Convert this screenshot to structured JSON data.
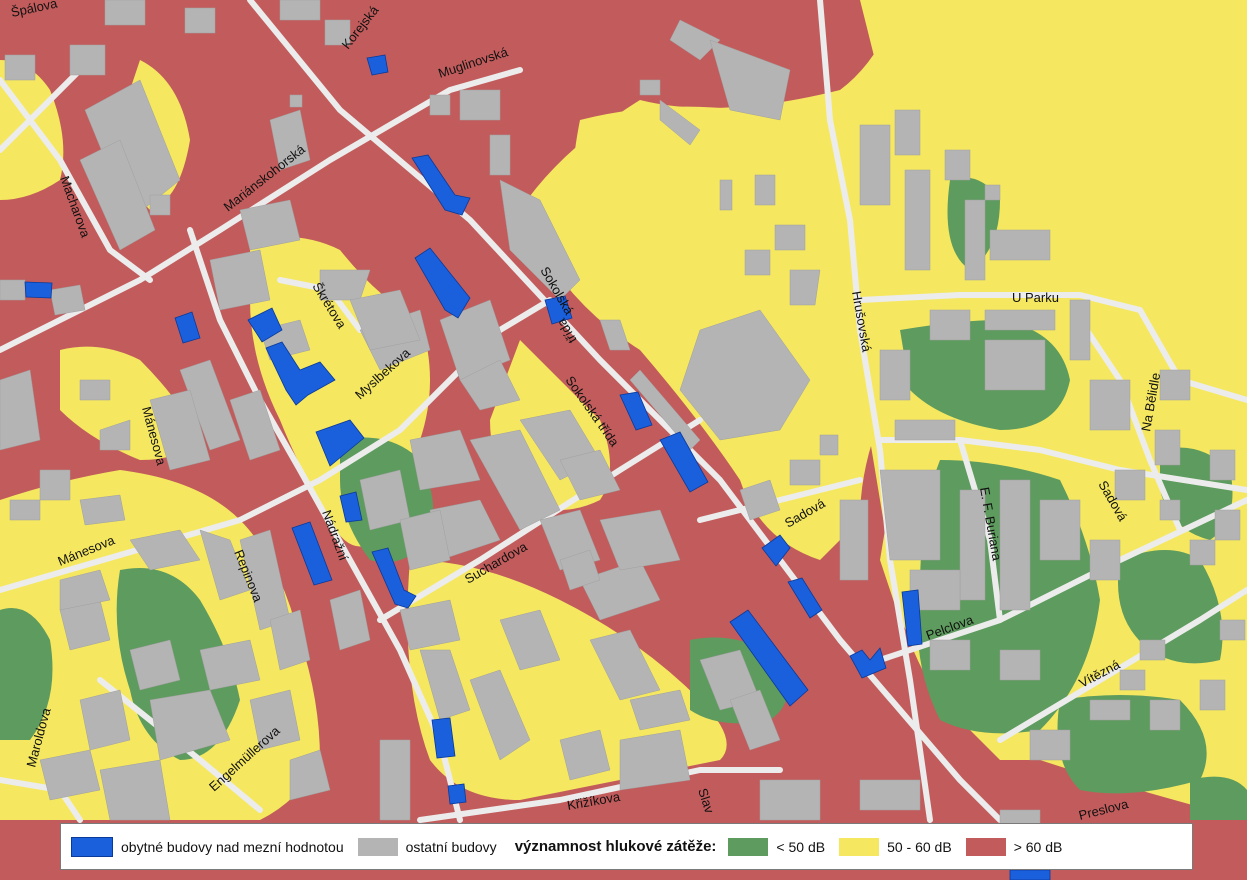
{
  "colors": {
    "loud": "#c25c5c",
    "medium": "#f5e860",
    "quiet": "#5e9b5e",
    "building": "#b4b4b4",
    "residential_over_limit": "#1a5fdc",
    "road": "#ececec"
  },
  "streets": {
    "spalova": "Špálova",
    "korejska": "Korejská",
    "muglinovska": "Muglinovská",
    "mariankohorska": "Mariánskohorská",
    "macharova": "Macharova",
    "skretova": "Škrétova",
    "myslbekova": "Myslbekova",
    "sokolska_1": "Sokolská",
    "sokolska_1b": "třída",
    "sokolska_2": "Sokolská třída",
    "hrusovska": "Hrušovská",
    "u_parku": "U Parku",
    "na_belidle": "Na Bělidle",
    "manesova_v": "Mánesova",
    "manesova_h": "Mánesova",
    "repinova": "Repinova",
    "nadrazni": "Nádražní",
    "suchardova": "Suchardova",
    "sadova_1": "Sadová",
    "sadova_2": "Sadová",
    "ef_buriana": "E. F. Buriana",
    "pelclova": "Pelclova",
    "vitezna": "Vítězná",
    "maroldova": "Maroldova",
    "engelmullerova": "Engelmüllerova",
    "krizikova": "Křižíkova",
    "slavikova": "Slav",
    "preslova": "Preslova"
  },
  "legend": {
    "residential_label": "obytné budovy nad mezní hodnotou",
    "other_label": "ostatní budovy",
    "title": "významnost hlukové zátěže:",
    "quiet_label": "< 50 dB",
    "medium_label": "50 - 60 dB",
    "loud_label": "> 60 dB"
  }
}
